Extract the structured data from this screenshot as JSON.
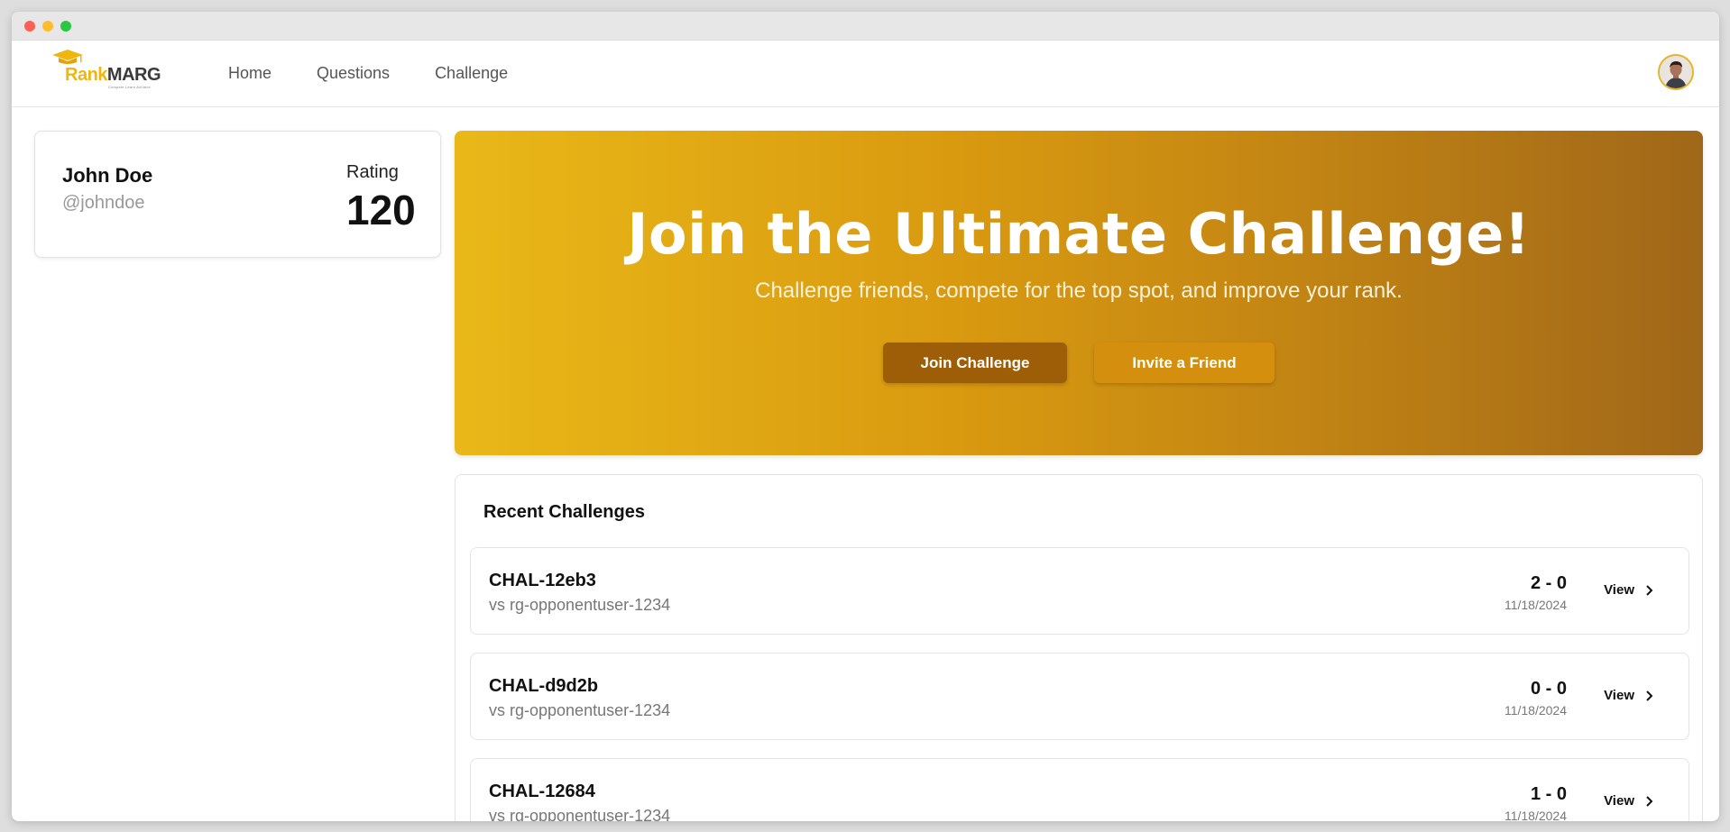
{
  "brand": {
    "name_part1": "Rank",
    "name_part2": "MARG",
    "tagline": "Compete Learn Achieve"
  },
  "nav": {
    "items": [
      "Home",
      "Questions",
      "Challenge"
    ]
  },
  "profile": {
    "name": "John Doe",
    "handle": "@johndoe",
    "rating_label": "Rating",
    "rating_value": "120"
  },
  "hero": {
    "title": "Join the Ultimate Challenge!",
    "subtitle": "Challenge friends, compete for the top spot, and improve your rank.",
    "join_label": "Join Challenge",
    "invite_label": "Invite a Friend"
  },
  "recent": {
    "title": "Recent Challenges",
    "view_label": "View",
    "items": [
      {
        "id": "CHAL-12eb3",
        "opponent": "vs rg-opponentuser-1234",
        "score": "2 - 0",
        "date": "11/18/2024"
      },
      {
        "id": "CHAL-d9d2b",
        "opponent": "vs rg-opponentuser-1234",
        "score": "0 - 0",
        "date": "11/18/2024"
      },
      {
        "id": "CHAL-12684",
        "opponent": "vs rg-opponentuser-1234",
        "score": "1 - 0",
        "date": "11/18/2024"
      }
    ]
  },
  "colors": {
    "accent": "#efb60f",
    "hero_start": "#e9b818",
    "hero_end": "#a06719",
    "join_button": "#9e5e08",
    "invite_button": "#d38f0d"
  },
  "icons": {
    "logo": "graduation-cap-icon",
    "view": "chevron-right-icon",
    "avatar": "user-avatar"
  }
}
